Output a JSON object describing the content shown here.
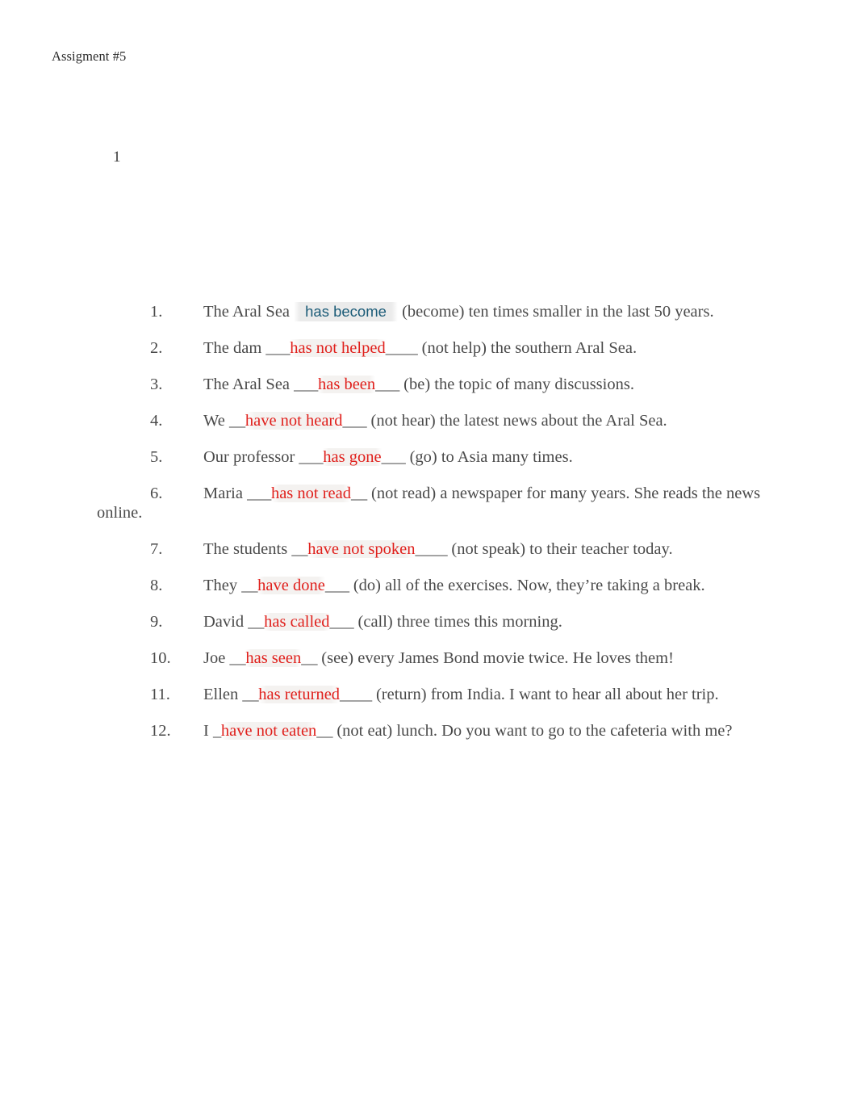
{
  "document": {
    "header": "Assigment #5",
    "page_number": "1",
    "accent_answer_color": "#1c5c78",
    "answer_color": "#e0201c",
    "body_color": "#4a4a4a"
  },
  "exercises": [
    {
      "number": "1.",
      "before": "The Aral Sea ",
      "blank_before": "",
      "answer": "has become",
      "answer_style": "teal",
      "blank_after": "",
      "after": " (become) ten times smaller in the last 50 years.",
      "tail": ""
    },
    {
      "number": "2.",
      "before": "The dam ",
      "blank_before": "___",
      "answer": "has not helped",
      "answer_style": "red",
      "blank_after": "____",
      "after": " (not help) the southern Aral Sea.",
      "tail": ""
    },
    {
      "number": "3.",
      "before": "The Aral Sea ",
      "blank_before": "___",
      "answer": "has been",
      "answer_style": "red",
      "blank_after": "___",
      "after": " (be) the topic of many discussions.",
      "tail": ""
    },
    {
      "number": "4.",
      "before": "We ",
      "blank_before": "__",
      "answer": "have not heard",
      "answer_style": "red",
      "blank_after": "___",
      "after": " (not hear) the latest news about the Aral Sea.",
      "tail": ""
    },
    {
      "number": "5.",
      "before": "Our professor ",
      "blank_before": "___",
      "answer": "has gone",
      "answer_style": "red",
      "blank_after": "___",
      "after": " (go) to Asia many times.",
      "tail": ""
    },
    {
      "number": "6.",
      "before": "Maria ",
      "blank_before": "___",
      "answer": "has not read",
      "answer_style": "red",
      "blank_after": "__",
      "after": " (not read) a newspaper for many years. She reads the news",
      "tail": "online."
    },
    {
      "number": "7.",
      "before": "The students ",
      "blank_before": "__",
      "answer": "have not spoken",
      "answer_style": "red",
      "blank_after": "____",
      "after": " (not speak) to their teacher today.",
      "tail": ""
    },
    {
      "number": "8.",
      "before": "They ",
      "blank_before": "__",
      "answer": "have done",
      "answer_style": "red",
      "blank_after": "___",
      "after": " (do) all of the exercises. Now, they’re taking a break.",
      "tail": ""
    },
    {
      "number": "9.",
      "before": "David ",
      "blank_before": "__",
      "answer": "has called",
      "answer_style": "red",
      "blank_after": "___",
      "after": " (call) three times this morning.",
      "tail": ""
    },
    {
      "number": "10.",
      "before": "Joe ",
      "blank_before": "__",
      "answer": "has seen",
      "answer_style": "red",
      "blank_after": "__",
      "after": " (see) every James Bond movie twice. He loves them!",
      "tail": ""
    },
    {
      "number": "11.",
      "before": "Ellen ",
      "blank_before": "__",
      "answer": "has returned",
      "answer_style": "red",
      "blank_after": "____",
      "after": " (return) from India. I want to hear all about her trip.",
      "tail": ""
    },
    {
      "number": "12.",
      "before": "I ",
      "blank_before": "_",
      "answer": "have not eaten",
      "answer_style": "red",
      "blank_after": "__",
      "after": " (not eat) lunch. Do you want to go to the cafeteria with me?",
      "tail": ""
    }
  ]
}
